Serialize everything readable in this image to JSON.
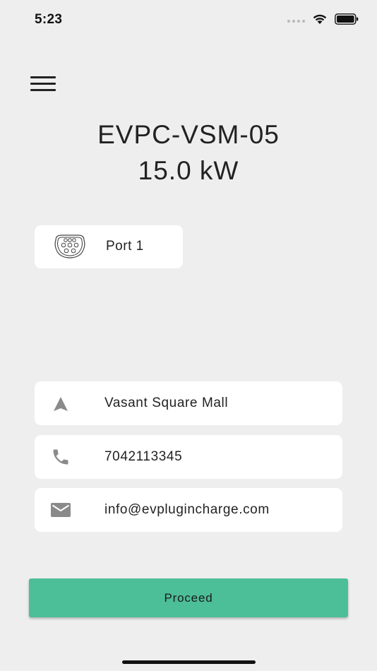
{
  "status_bar": {
    "time": "5:23"
  },
  "header": {
    "station_name": "EVPC-VSM-05",
    "power": "15.0 kW"
  },
  "port": {
    "label": "Port 1",
    "icon": "connector-icon"
  },
  "info": {
    "location": {
      "text": "Vasant Square Mall",
      "icon": "navigation-arrow-icon"
    },
    "phone": {
      "text": "7042113345",
      "icon": "phone-icon"
    },
    "email": {
      "text": "info@evplugincharge.com",
      "icon": "mail-icon"
    }
  },
  "actions": {
    "proceed_label": "Proceed"
  },
  "colors": {
    "background": "#eeeeee",
    "card": "#ffffff",
    "accent": "#4cbe98",
    "icon_gray": "#8a8a8a"
  }
}
